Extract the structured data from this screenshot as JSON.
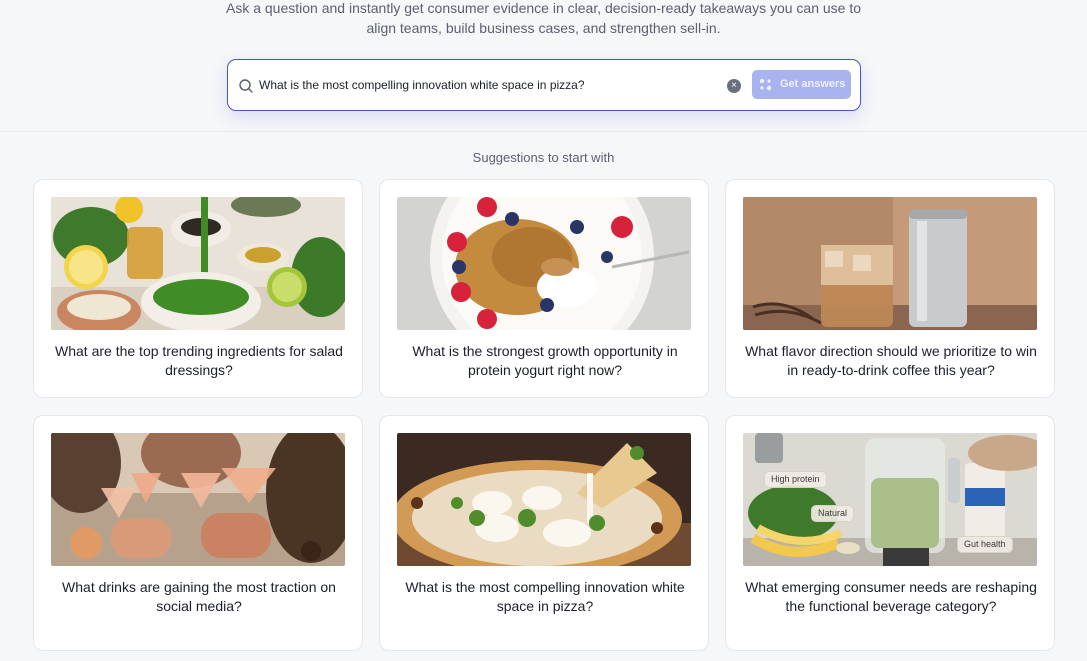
{
  "header": {
    "subtitle_line1": "Ask a question and instantly get consumer evidence in clear, decision-ready takeaways you can use to",
    "subtitle_line2": "align teams, build business cases, and strengthen sell-in."
  },
  "search": {
    "query": "What is the most compelling innovation white space in pizza?",
    "clear_icon": "×",
    "button_label": "Get answers"
  },
  "suggestions": {
    "title": "Suggestions to start with",
    "cards": [
      {
        "question": "What are the top trending ingredients for salad dressings?"
      },
      {
        "question": "What is the strongest growth opportunity in protein yogurt right now?"
      },
      {
        "question": "What flavor direction should we prioritize to win in ready-to-drink coffee this year?"
      },
      {
        "question": "What drinks are gaining the most traction on social media?"
      },
      {
        "question": "What is the most compelling innovation white space in pizza?"
      },
      {
        "question": "What emerging consumer needs are reshaping the functional beverage category?",
        "tags": [
          "High protein",
          "Natural",
          "Gut health"
        ]
      }
    ]
  },
  "colors": {
    "accent": "#4454d6",
    "button": "#a9b3f0"
  }
}
